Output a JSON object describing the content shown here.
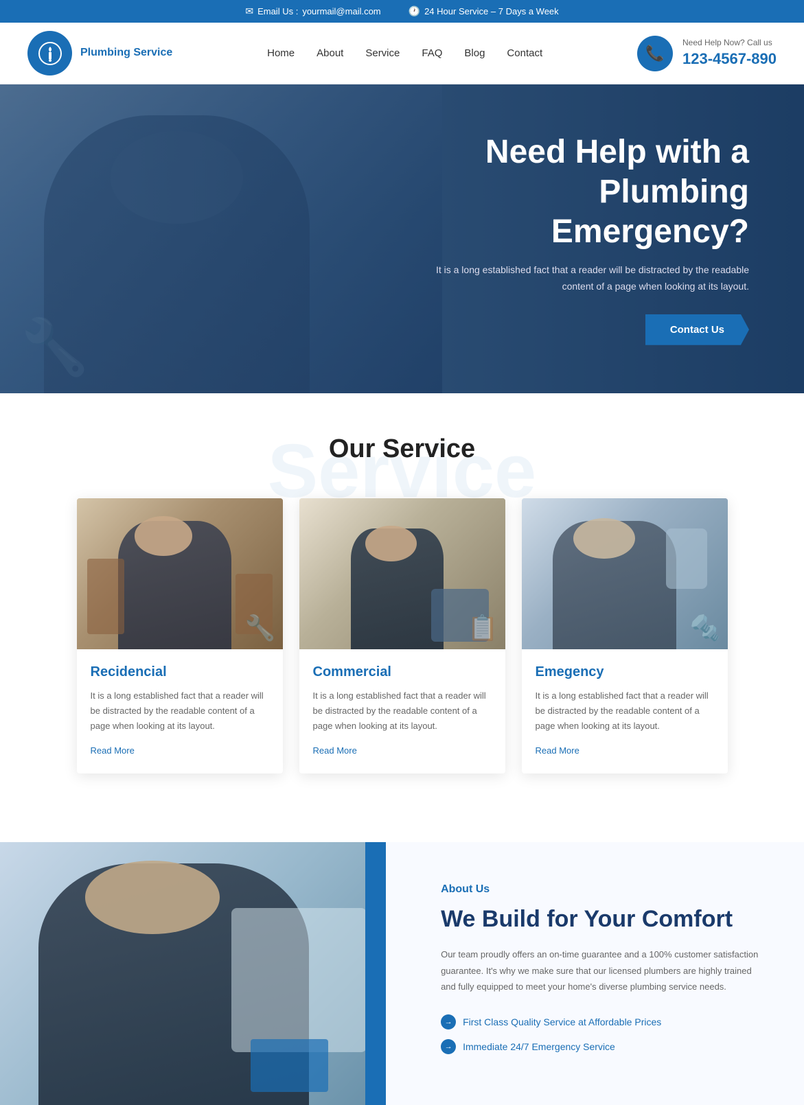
{
  "topbar": {
    "email_label": "Email Us :",
    "email_value": "yourmail@mail.com",
    "service_hours": "24 Hour Service – 7 Days a Week"
  },
  "header": {
    "logo_text": "Plumbing Service",
    "nav": {
      "items": [
        {
          "label": "Home",
          "href": "#"
        },
        {
          "label": "About",
          "href": "#"
        },
        {
          "label": "Service",
          "href": "#"
        },
        {
          "label": "FAQ",
          "href": "#"
        },
        {
          "label": "Blog",
          "href": "#"
        },
        {
          "label": "Contact",
          "href": "#"
        }
      ]
    },
    "phone": {
      "need_help_label": "Need Help Now? Call us",
      "phone_number": "123-4567-890"
    }
  },
  "hero": {
    "title_line1": "Need Help with a",
    "title_line2": "Plumbing Emergency?",
    "subtitle": "It is a long established fact that a reader will be distracted by the readable content of a page when looking at its layout.",
    "cta_label": "Contact Us"
  },
  "services": {
    "bg_text": "Service",
    "section_title": "Our Service",
    "cards": [
      {
        "id": "residential",
        "title": "Recidencial",
        "text": "It is a long established fact that a reader will be distracted by the readable content of a page when looking at its layout.",
        "read_more_label": "Read More"
      },
      {
        "id": "commercial",
        "title": "Commercial",
        "text": "It is a long established fact that a reader will be distracted by the readable content of a page when looking at its layout.",
        "read_more_label": "Read More"
      },
      {
        "id": "emergency",
        "title": "Emegency",
        "text": "It is a long established fact that a reader will be distracted by the readable content of a page when looking at its layout.",
        "read_more_label": "Read More"
      }
    ]
  },
  "about": {
    "label": "About Us",
    "title": "We Build for Your Comfort",
    "text": "Our team proudly offers an on-time guarantee and a 100% customer satisfaction guarantee. It's why we make sure that our licensed plumbers are highly trained and fully equipped to meet your home's diverse plumbing service needs.",
    "features": [
      "First Class Quality Service at Affordable Prices",
      "Immediate 24/7 Emergency Service"
    ]
  },
  "colors": {
    "primary": "#1a6eb5",
    "dark_blue": "#1a3a6b",
    "text_gray": "#666666"
  }
}
